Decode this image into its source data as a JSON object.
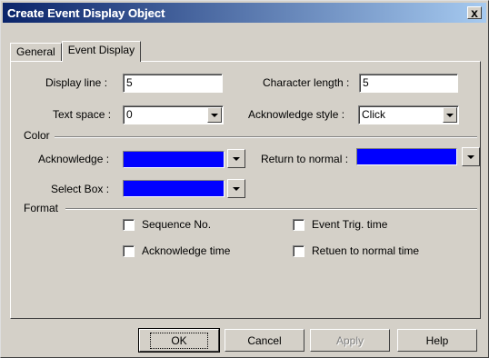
{
  "window": {
    "title": "Create Event Display Object"
  },
  "tabs": [
    {
      "label": "General"
    },
    {
      "label": "Event Display"
    }
  ],
  "fields": {
    "display_line": {
      "label": "Display line :",
      "value": "5"
    },
    "character_length": {
      "label": "Character length :",
      "value": "5"
    },
    "text_space": {
      "label": "Text space :",
      "value": "0"
    },
    "acknowledge_style": {
      "label": "Acknowledge style :",
      "value": "Click"
    }
  },
  "color_group": {
    "title": "Color",
    "acknowledge_label": "Acknowledge :",
    "return_to_normal_label": "Return to normal :",
    "select_box_label": "Select Box :",
    "swatch_color": "#0000ff"
  },
  "format_group": {
    "title": "Format",
    "checkboxes": [
      {
        "label": "Sequence No.",
        "checked": false
      },
      {
        "label": "Event Trig. time",
        "checked": false
      },
      {
        "label": "Acknowledge time",
        "checked": false
      },
      {
        "label": "Retuen to normal time",
        "checked": false
      }
    ]
  },
  "buttons": {
    "ok": "OK",
    "cancel": "Cancel",
    "apply": "Apply",
    "help": "Help"
  },
  "close_label": "x"
}
